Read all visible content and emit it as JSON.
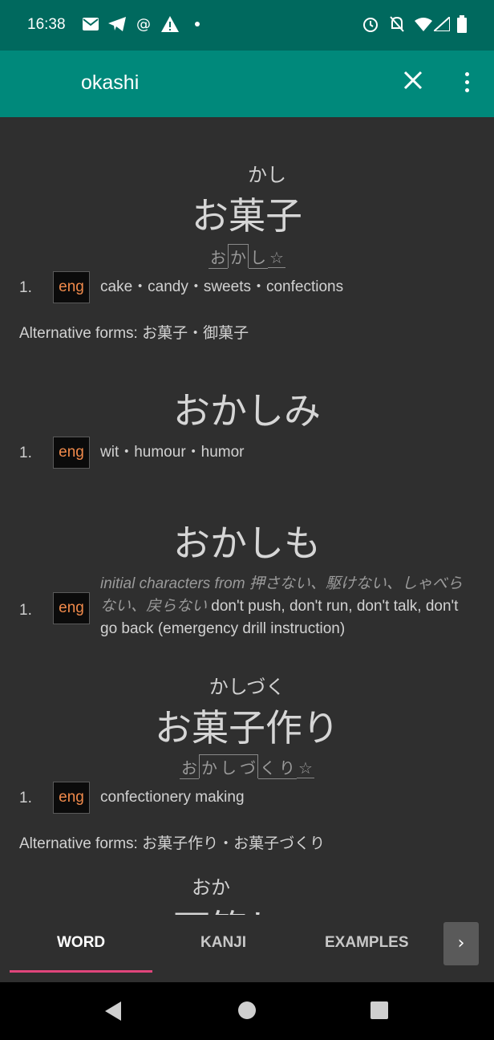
{
  "status_bar": {
    "time": "16:38",
    "left_icons": [
      "mail-icon",
      "telegram-icon",
      "at-icon",
      "warning-icon",
      "dot-icon"
    ],
    "right_icons": [
      "alarm-icon",
      "bell-off-icon",
      "wifi-icon",
      "signal-icon",
      "battery-icon"
    ]
  },
  "app_bar": {
    "search_value": "okashi",
    "close_icon": "close-icon",
    "menu_icon": "more-vert-icon"
  },
  "entries": [
    {
      "furigana": "かし",
      "word": "お菓子",
      "pitch": [
        "お",
        "か",
        "し",
        "☆"
      ],
      "senses": [
        {
          "num": "1.",
          "tag": "eng",
          "gloss": "cake・candy・sweets・confections"
        }
      ],
      "alt_forms": "Alternative forms: お菓子・御菓子"
    },
    {
      "furigana": "",
      "word": "おかしみ",
      "senses": [
        {
          "num": "1.",
          "tag": "eng",
          "gloss": "wit・humour・humor"
        }
      ]
    },
    {
      "furigana": "",
      "word": "おかしも",
      "senses": [
        {
          "num": "1.",
          "tag": "eng",
          "note": "initial characters from 押さない、駆けない、しゃべらない、戻らない",
          "gloss": " don't push, don't run, don't talk, don't go back (emergency drill instruction)"
        }
      ]
    },
    {
      "furigana": "かしづく",
      "word": "お菓子作り",
      "pitch": [
        "お",
        "か",
        "し",
        "づ",
        "く",
        "り",
        "☆"
      ],
      "senses": [
        {
          "num": "1.",
          "tag": "eng",
          "gloss": "confectionery making"
        }
      ],
      "alt_forms": "Alternative forms: お菓子作り・お菓子づくり"
    },
    {
      "furigana": "おか",
      "word": "可笑しい"
    }
  ],
  "tabs": [
    {
      "label": "WORD",
      "active": true
    },
    {
      "label": "KANJI",
      "active": false
    },
    {
      "label": "EXAMPLES",
      "active": false
    }
  ],
  "tab_scroll_icon": "chevron-right-icon",
  "nav_bar": [
    "back-icon",
    "home-icon",
    "recents-icon"
  ],
  "colors": {
    "status_bar": "#00695e",
    "app_bar": "#00897b",
    "background": "#2f2f2f",
    "tag_text": "#f08a4b",
    "tab_indicator": "#e0457b"
  }
}
